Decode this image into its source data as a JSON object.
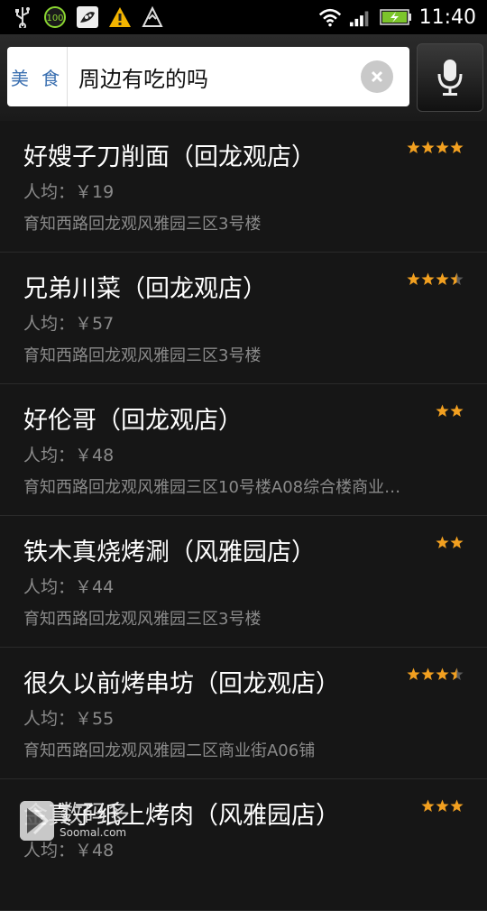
{
  "status_bar": {
    "time": "11:40",
    "icons": [
      "usb-icon",
      "battery-100-badge-icon",
      "app-notification-icon",
      "warning-icon",
      "data-sync-icon",
      "wifi-icon",
      "signal-icon",
      "battery-charging-icon"
    ],
    "battery_badge": "100"
  },
  "search": {
    "category": "美 食",
    "query": "周边有吃的吗"
  },
  "colors": {
    "star": "#f2a020",
    "star_empty": "#5a5a5a",
    "category_text": "#3a6fb0"
  },
  "results": [
    {
      "name": "好嫂子刀削面（回龙观店）",
      "price": "人均：￥19",
      "address": "育知西路回龙观风雅园三区3号楼",
      "rating": 4
    },
    {
      "name": "兄弟川菜（回龙观店）",
      "price": "人均：￥57",
      "address": "育知西路回龙观风雅园三区3号楼",
      "rating": 3.5
    },
    {
      "name": "好伦哥（回龙观店）",
      "price": "人均：￥48",
      "address": "育知西路回龙观风雅园三区10号楼A08综合楼商业…",
      "rating": 2
    },
    {
      "name": "铁木真烧烤涮（风雅园店）",
      "price": "人均：￥44",
      "address": "育知西路回龙观风雅园三区3号楼",
      "rating": 2
    },
    {
      "name": "很久以前烤串坊（回龙观店）",
      "price": "人均：￥55",
      "address": "育知西路回龙观风雅园二区商业街A06铺",
      "rating": 3.5
    },
    {
      "name": "金真子纸上烤肉（风雅园店）",
      "price": "人均：￥48",
      "address": "",
      "rating": 3
    }
  ],
  "watermark": {
    "text": "数码多",
    "subtext": "Soomal.com"
  }
}
